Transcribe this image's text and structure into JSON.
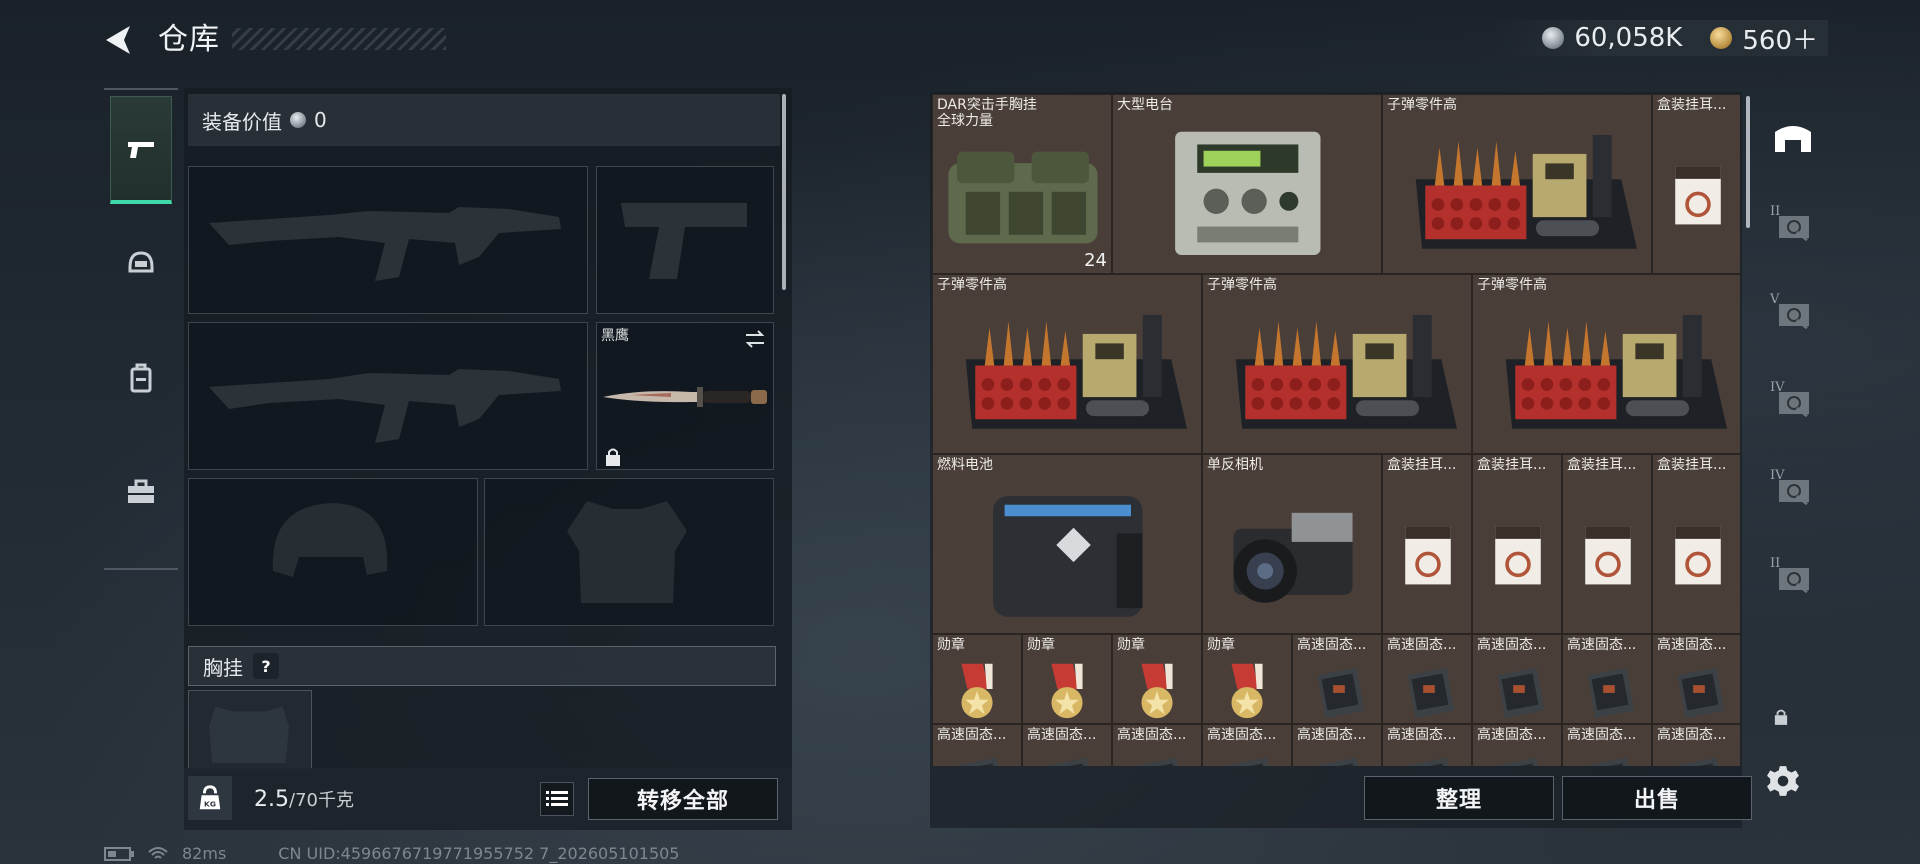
{
  "header": {
    "title": "仓库",
    "currency_silver": "60,058K",
    "currency_gold": "560＋"
  },
  "left_tabs": [
    {
      "icon": "pistol-icon",
      "active": true
    },
    {
      "icon": "helmet-icon",
      "active": false
    },
    {
      "icon": "backpack-icon",
      "active": false
    },
    {
      "icon": "toolbox-icon",
      "active": false
    }
  ],
  "equipment": {
    "value_label": "装备价值",
    "value": "0",
    "melee_label": "黑鹰",
    "vest_label": "胸挂",
    "help_mark": "?"
  },
  "weight": {
    "current": "2.5",
    "max": "/70千克",
    "kg_mark": "KG"
  },
  "buttons": {
    "transfer_all": "转移全部",
    "organize": "整理",
    "sell": "出售"
  },
  "inventory": {
    "items": [
      {
        "name": "DAR突击手胸挂\n全球力量",
        "icon": "chest-rig-icon",
        "stack": "24"
      },
      {
        "name": "大型电台",
        "icon": "radio-icon"
      },
      {
        "name": "子弹零件高",
        "icon": "ammo-parts-icon"
      },
      {
        "name": "盒装挂耳...",
        "icon": "coffee-box-icon"
      },
      {
        "name": "子弹零件高",
        "icon": "ammo-parts-icon"
      },
      {
        "name": "子弹零件高",
        "icon": "ammo-parts-icon"
      },
      {
        "name": "子弹零件高",
        "icon": "ammo-parts-icon"
      },
      {
        "name": "燃料电池",
        "icon": "fuel-cell-icon"
      },
      {
        "name": "单反相机",
        "icon": "camera-icon"
      },
      {
        "name": "盒装挂耳...",
        "icon": "coffee-box-icon"
      },
      {
        "name": "盒装挂耳...",
        "icon": "coffee-box-icon"
      },
      {
        "name": "盒装挂耳...",
        "icon": "coffee-box-icon"
      },
      {
        "name": "盒装挂耳...",
        "icon": "coffee-box-icon"
      },
      {
        "name": "勋章",
        "icon": "medal-icon"
      },
      {
        "name": "勋章",
        "icon": "medal-icon"
      },
      {
        "name": "勋章",
        "icon": "medal-icon"
      },
      {
        "name": "勋章",
        "icon": "medal-icon"
      },
      {
        "name": "高速固态...",
        "icon": "ssd-icon"
      },
      {
        "name": "高速固态...",
        "icon": "ssd-icon"
      },
      {
        "name": "高速固态...",
        "icon": "ssd-icon"
      },
      {
        "name": "高速固态...",
        "icon": "ssd-icon"
      },
      {
        "name": "高速固态...",
        "icon": "ssd-icon"
      },
      {
        "name": "高速固态...",
        "icon": "ssd-icon"
      },
      {
        "name": "高速固态...",
        "icon": "ssd-icon"
      },
      {
        "name": "高速固态...",
        "icon": "ssd-icon"
      },
      {
        "name": "高速固态...",
        "icon": "ssd-icon"
      },
      {
        "name": "高速固态...",
        "icon": "ssd-icon"
      },
      {
        "name": "高速固态...",
        "icon": "ssd-icon"
      },
      {
        "name": "高速固态...",
        "icon": "ssd-icon"
      },
      {
        "name": "高速固态...",
        "icon": "ssd-icon"
      },
      {
        "name": "高速固态...",
        "icon": "ssd-icon"
      }
    ]
  },
  "right_tabs": [
    {
      "icon": "bunker-icon",
      "numeral": ""
    },
    {
      "icon": "safe-box-icon",
      "numeral": "II"
    },
    {
      "icon": "safe-box-icon",
      "numeral": "V"
    },
    {
      "icon": "safe-box-icon",
      "numeral": "IV"
    },
    {
      "icon": "safe-box-icon",
      "numeral": "IV"
    },
    {
      "icon": "safe-box-icon",
      "numeral": "II"
    }
  ],
  "status": {
    "ping": "82ms",
    "uid": "CN UID:4596676719771955752 7_202605101505"
  },
  "colors": {
    "accent": "#3fd8a8",
    "grid_bg": "#4a3e39"
  }
}
